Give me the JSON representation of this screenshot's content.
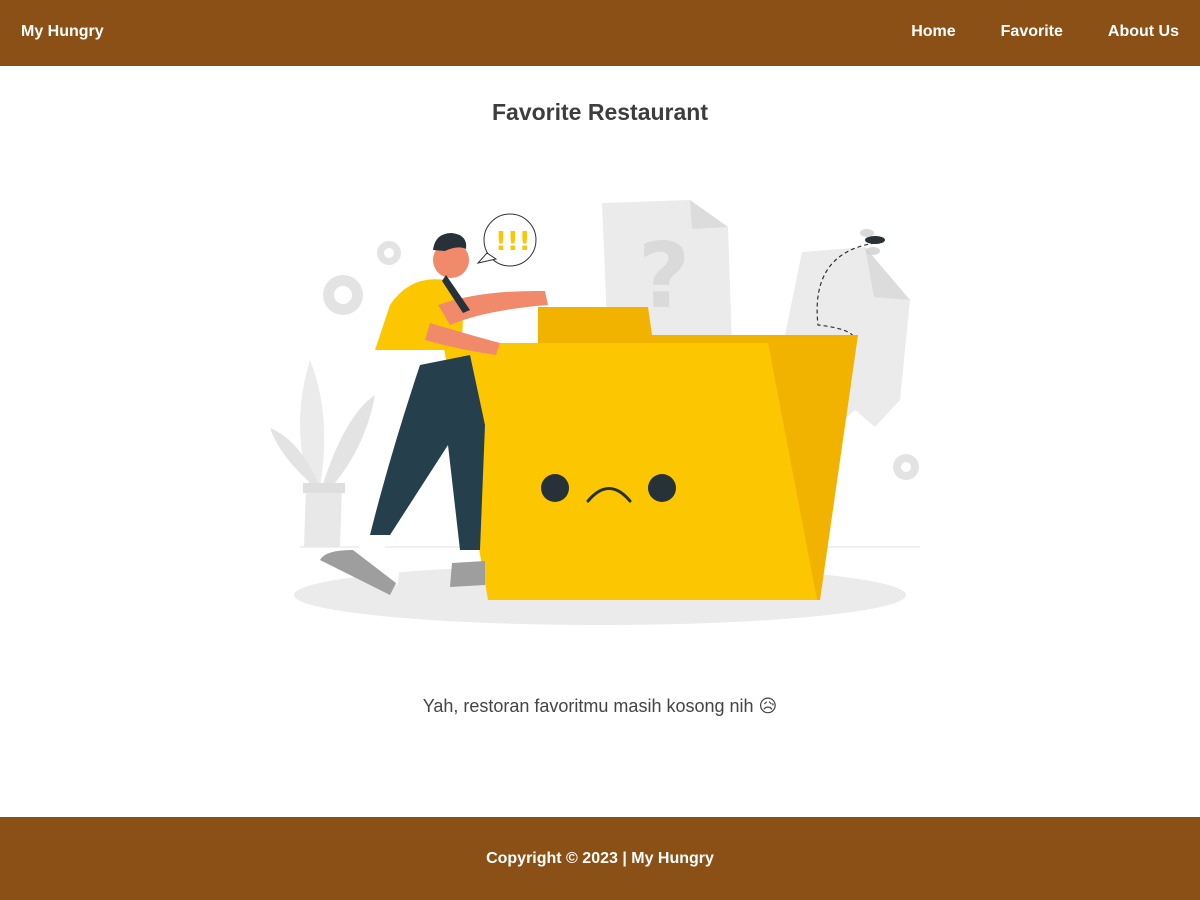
{
  "colors": {
    "brand_brown": "#8b5016",
    "folder_yellow": "#fdc700",
    "folder_dark_yellow": "#f2b300",
    "text_dark": "#3d3d3d"
  },
  "header": {
    "brand": "My Hungry",
    "nav": [
      {
        "label": "Home"
      },
      {
        "label": "Favorite"
      },
      {
        "label": "About Us"
      }
    ]
  },
  "main": {
    "title": "Favorite Restaurant",
    "illustration": {
      "icon": "empty-folder-illustration",
      "bubble_text": "!!!",
      "question_mark": "?"
    },
    "empty_message": "Yah, restoran favoritmu masih kosong nih 😥"
  },
  "footer": {
    "copyright": "Copyright © 2023 | My Hungry"
  }
}
